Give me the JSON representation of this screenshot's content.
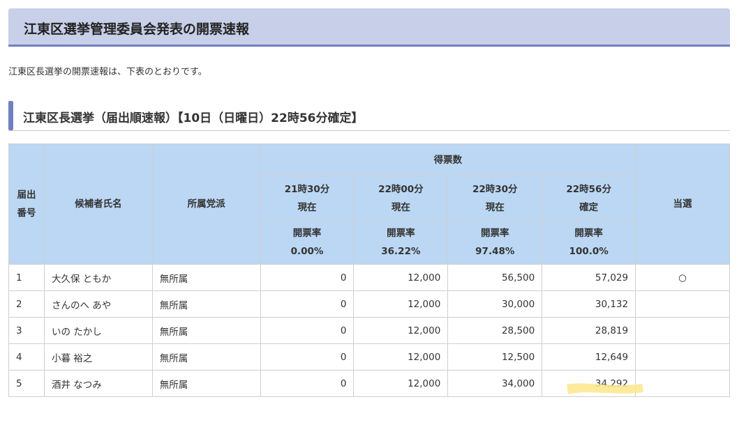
{
  "page_title": "江東区選挙管理委員会発表の開票速報",
  "intro": "江東区長選挙の開票速報は、下表のとおりです。",
  "section_title": "江東区長選挙（届出順速報）【10日（日曜日）22時56分確定】",
  "table": {
    "headers": {
      "number": [
        "届出",
        "番号"
      ],
      "name": "候補者氏名",
      "party": "所属党派",
      "votes": "得票数",
      "elected": "当選"
    },
    "time_columns": [
      {
        "time": "21時30分",
        "status": "現在",
        "rate_label": "開票率",
        "rate": "0.00%"
      },
      {
        "time": "22時00分",
        "status": "現在",
        "rate_label": "開票率",
        "rate": "36.22%"
      },
      {
        "time": "22時30分",
        "status": "現在",
        "rate_label": "開票率",
        "rate": "97.48%"
      },
      {
        "time": "22時56分",
        "status": "確定",
        "rate_label": "開票率",
        "rate": "100.0%"
      }
    ],
    "rows": [
      {
        "no": "1",
        "name": "大久保 ともか",
        "party": "無所属",
        "votes": [
          "0",
          "12,000",
          "56,500",
          "57,029"
        ],
        "elected": "○"
      },
      {
        "no": "2",
        "name": "さんのへ あや",
        "party": "無所属",
        "votes": [
          "0",
          "12,000",
          "30,000",
          "30,132"
        ],
        "elected": ""
      },
      {
        "no": "3",
        "name": "いの たかし",
        "party": "無所属",
        "votes": [
          "0",
          "12,000",
          "28,500",
          "28,819"
        ],
        "elected": ""
      },
      {
        "no": "4",
        "name": "小暮 裕之",
        "party": "無所属",
        "votes": [
          "0",
          "12,000",
          "12,500",
          "12,649"
        ],
        "elected": ""
      },
      {
        "no": "5",
        "name": "酒井 なつみ",
        "party": "無所属",
        "votes": [
          "0",
          "12,000",
          "34,000",
          "34,292"
        ],
        "elected": ""
      }
    ]
  },
  "colors": {
    "header_bg": "#c8cfe8",
    "accent": "#6f7fbf",
    "table_header_bg": "#bcd7f3",
    "highlight": "#fde68a"
  }
}
